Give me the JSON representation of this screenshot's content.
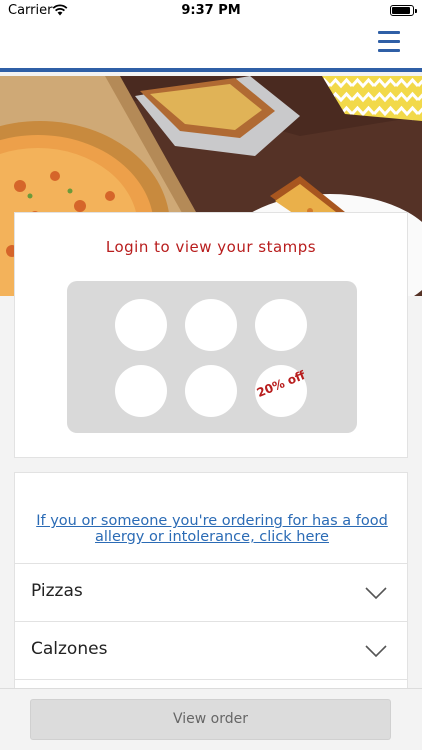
{
  "status_bar": {
    "carrier": "Carrier",
    "time": "9:37 PM"
  },
  "header": {
    "menu_icon": "hamburger-menu-icon",
    "accent_color": "#2f5fa6"
  },
  "stamps": {
    "login_text": "Login to view your stamps",
    "reward_text": "20% off",
    "slots_total": 6,
    "stamps_collected": 0,
    "text_color": "#b81d1d"
  },
  "menu": {
    "allergy_link": "If you or someone you're ordering for has a food allergy or intolerance, click here",
    "categories": [
      {
        "label": "Pizzas"
      },
      {
        "label": "Calzones"
      }
    ]
  },
  "footer": {
    "view_order_label": "View order"
  }
}
